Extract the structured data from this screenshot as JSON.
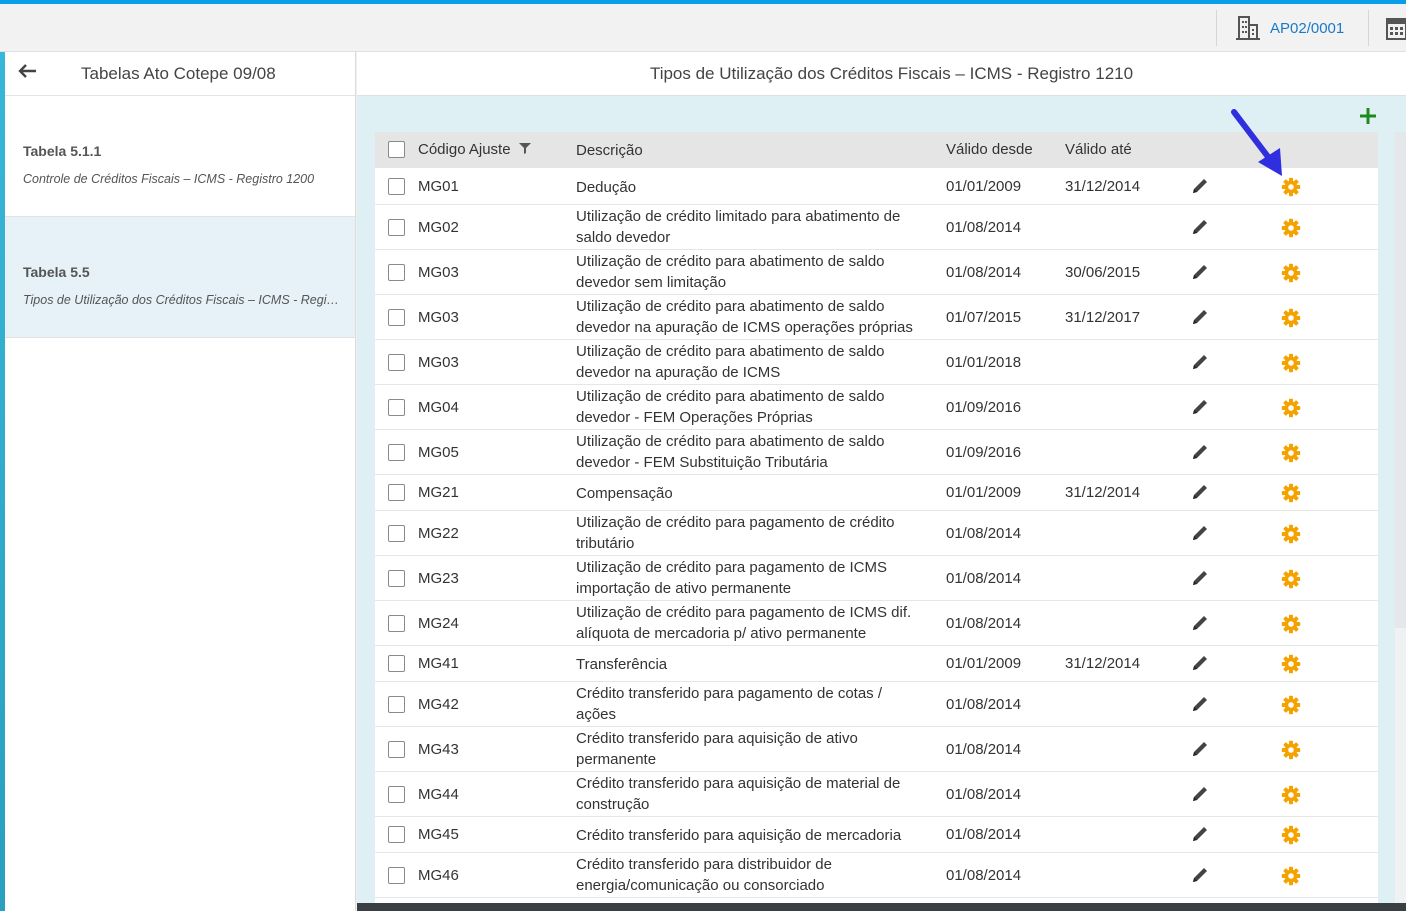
{
  "topbar": {
    "company_code": "AP02/0001",
    "company_icon": "building-icon",
    "calendar_icon": "calendar-icon"
  },
  "sidebar": {
    "back_icon": "back-arrow-icon",
    "title": "Tabelas Ato Cotepe 09/08",
    "items": [
      {
        "title": "Tabela 5.1.1",
        "subtitle": "Controle de Créditos Fiscais – ICMS - Registro 1200",
        "active": false
      },
      {
        "title": "Tabela 5.5",
        "subtitle": "Tipos de Utilização dos Créditos Fiscais – ICMS - Registro 1210",
        "active": true
      }
    ]
  },
  "main": {
    "title": "Tipos de Utilização dos Créditos Fiscais – ICMS - Registro 1210",
    "add_icon": "plus-icon",
    "columns": {
      "code": "Código Ajuste",
      "desc": "Descrição",
      "from": "Válido desde",
      "to": "Válido até"
    },
    "rows": [
      {
        "code": "MG01",
        "desc": "Dedução",
        "from": "01/01/2009",
        "to": "31/12/2014"
      },
      {
        "code": "MG02",
        "desc": "Utilização de crédito limitado para abatimento de saldo devedor",
        "from": "01/08/2014",
        "to": ""
      },
      {
        "code": "MG03",
        "desc": "Utilização de crédito para abatimento de saldo devedor sem limitação",
        "from": "01/08/2014",
        "to": "30/06/2015"
      },
      {
        "code": "MG03",
        "desc": "Utilização de crédito para abatimento de saldo devedor na apuração de ICMS operações próprias",
        "from": "01/07/2015",
        "to": "31/12/2017"
      },
      {
        "code": "MG03",
        "desc": "Utilização de crédito para abatimento de saldo devedor na apuração de ICMS",
        "from": "01/01/2018",
        "to": ""
      },
      {
        "code": "MG04",
        "desc": "Utilização de crédito para abatimento de saldo devedor - FEM Operações Próprias",
        "from": "01/09/2016",
        "to": ""
      },
      {
        "code": "MG05",
        "desc": "Utilização de crédito para abatimento de saldo devedor - FEM Substituição Tributária",
        "from": "01/09/2016",
        "to": ""
      },
      {
        "code": "MG21",
        "desc": "Compensação",
        "from": "01/01/2009",
        "to": "31/12/2014"
      },
      {
        "code": "MG22",
        "desc": "Utilização de crédito para pagamento de crédito tributário",
        "from": "01/08/2014",
        "to": ""
      },
      {
        "code": "MG23",
        "desc": "Utilização de crédito para pagamento de ICMS importação de ativo permanente",
        "from": "01/08/2014",
        "to": ""
      },
      {
        "code": "MG24",
        "desc": "Utilização de crédito para pagamento de ICMS dif. alíquota de mercadoria p/ ativo permanente",
        "from": "01/08/2014",
        "to": ""
      },
      {
        "code": "MG41",
        "desc": "Transferência",
        "from": "01/01/2009",
        "to": "31/12/2014"
      },
      {
        "code": "MG42",
        "desc": "Crédito transferido para pagamento de cotas / ações",
        "from": "01/08/2014",
        "to": ""
      },
      {
        "code": "MG43",
        "desc": "Crédito transferido para aquisição de ativo permanente",
        "from": "01/08/2014",
        "to": ""
      },
      {
        "code": "MG44",
        "desc": "Crédito transferido para aquisição de material de construção",
        "from": "01/08/2014",
        "to": ""
      },
      {
        "code": "MG45",
        "desc": "Crédito transferido para aquisição de mercadoria",
        "from": "01/08/2014",
        "to": ""
      },
      {
        "code": "MG46",
        "desc": "Crédito transferido para distribuidor de energia/comunicação ou consorciado",
        "from": "01/08/2014",
        "to": ""
      }
    ]
  },
  "colors": {
    "accent": "#0a9ee8",
    "gear": "#f5a200",
    "add": "#1e8a1e",
    "arrow": "#2f2fe0"
  }
}
